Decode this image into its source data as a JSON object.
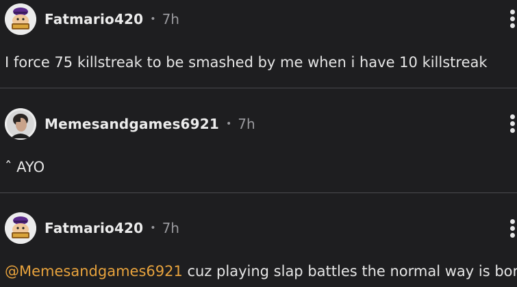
{
  "comments": [
    {
      "username": "Fatmario420",
      "separator": "•",
      "time": "7h",
      "text": "I force 75 killstreak to be smashed by me when i have 10 killstreak",
      "avatar_icon": "fat-mario-avatar"
    },
    {
      "username": "Memesandgames6921",
      "separator": "•",
      "time": "7h",
      "text": "ˆ AYO",
      "avatar_icon": "portrait-avatar"
    },
    {
      "username": "Fatmario420",
      "separator": "•",
      "time": "7h",
      "mention": "@Memesandgames6921",
      "text": " cuz playing slap battles the normal way is boring",
      "avatar_icon": "fat-mario-avatar"
    }
  ],
  "colors": {
    "background": "#1e1e20",
    "mention": "#e8a33d",
    "divider": "#4a4a4e"
  }
}
